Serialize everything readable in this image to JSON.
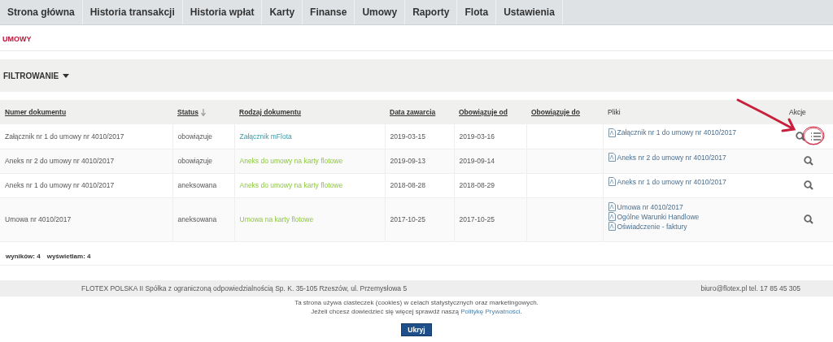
{
  "nav": [
    {
      "label": "Strona główna",
      "selected": false
    },
    {
      "label": "Historia transakcji",
      "selected": false
    },
    {
      "label": "Historia wpłat",
      "selected": false
    },
    {
      "label": "Karty",
      "selected": false
    },
    {
      "label": "Finanse",
      "selected": false
    },
    {
      "label": "Umowy",
      "selected": false
    },
    {
      "label": "Raporty",
      "selected": false
    },
    {
      "label": "Flota",
      "selected": false
    },
    {
      "label": "Ustawienia",
      "selected": false
    }
  ],
  "page_title": "UMOWY",
  "filter": {
    "label": "FILTROWANIE",
    "expanded": false
  },
  "table": {
    "columns": [
      {
        "label": "Numer dokumentu",
        "sortable": true,
        "sorted": false
      },
      {
        "label": "Status",
        "sortable": true,
        "sorted": true
      },
      {
        "label": "Rodzaj dokumentu",
        "sortable": true,
        "sorted": false
      },
      {
        "label": "Data zawarcia",
        "sortable": true,
        "sorted": false
      },
      {
        "label": "Obowiązuje od",
        "sortable": true,
        "sorted": false
      },
      {
        "label": "Obowiązuje do",
        "sortable": true,
        "sorted": false
      },
      {
        "label": "Pliki",
        "sortable": false,
        "sorted": false
      },
      {
        "label": "Akcje",
        "sortable": false,
        "sorted": false
      }
    ],
    "rows": [
      {
        "number": "Załącznik nr 1 do umowy nr 4010/2017",
        "status": "obowiązuje",
        "type": {
          "label": "Załącznik mFlota",
          "kind": "attachment"
        },
        "concluded": "2019-03-15",
        "valid_from": "2019-03-16",
        "files": [
          "Załącznik nr 1 do umowy nr 4010/2017"
        ],
        "actions": [
          {
            "kind": "search"
          },
          {
            "kind": "list"
          }
        ]
      },
      {
        "number": "Aneks nr 2 do umowy nr 4010/2017",
        "status": "obowiązuje",
        "type": {
          "label": "Aneks do umowy na karty flotowe",
          "kind": "fleet"
        },
        "concluded": "2019-09-13",
        "valid_from": "2019-09-14",
        "files": [
          "Aneks nr 2 do umowy nr 4010/2017"
        ],
        "actions": [
          {
            "kind": "search"
          }
        ]
      },
      {
        "number": "Aneks nr 1 do umowy nr 4010/2017",
        "status": "aneksowana",
        "type": {
          "label": "Aneks do umowy na karty flotowe",
          "kind": "fleet"
        },
        "concluded": "2018-08-28",
        "valid_from": "2018-08-29",
        "files": [
          "Aneks nr 1 do umowy nr 4010/2017"
        ],
        "actions": [
          {
            "kind": "search"
          }
        ]
      },
      {
        "number": "Umowa nr 4010/2017",
        "status": "aneksowana",
        "type": {
          "label": "Umowa na karty flotowe",
          "kind": "fleet"
        },
        "concluded": "2017-10-25",
        "valid_from": "2017-10-25",
        "files": [
          "Umowa nr 4010/2017",
          "Ogólne Warunki Handlowe",
          "Oświadczenie - faktury"
        ],
        "actions": [
          {
            "kind": "search"
          }
        ]
      }
    ]
  },
  "summary": {
    "results_label": "wyników:",
    "results": "4",
    "shown_label": "wyświetlam:",
    "shown": "4"
  },
  "footer": {
    "company": "FLOTEX POLSKA II Spółka z ograniczoną odpowiedzialnością Sp. K. 35-105 Rzeszów, ul. Przemysłowa 5",
    "contact": "biuro@flotex.pl tel. 17 85 45 305"
  },
  "cookies": {
    "line1": "Ta strona używa ciasteczek (cookies) w celach statystycznych oraz marketingowych.",
    "line2": "Jeżeli chcesz dowiedzieć się więcej sprawdź naszą",
    "link": "Politykę Prywatności",
    "end": ".",
    "button": "Ukryj"
  }
}
